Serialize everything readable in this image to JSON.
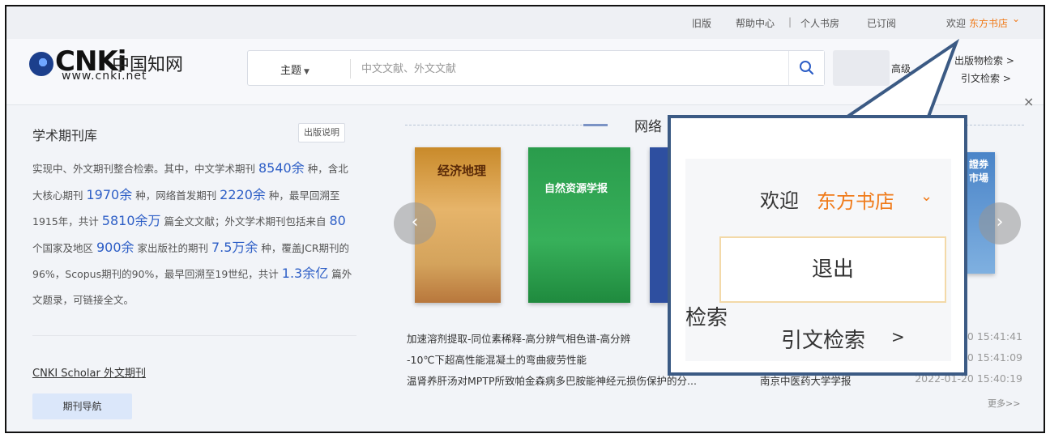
{
  "topbar": {
    "old_version": "旧版",
    "help": "帮助中心",
    "separator": "|",
    "personal": "个人书房",
    "subscribed": "已订阅",
    "welcome": "欢迎",
    "user": "东方书店",
    "caret": "⌄"
  },
  "header": {
    "logo_text": "CNKi",
    "logo_cn": "中国知网",
    "logo_url": "www.cnki.net",
    "search_type": "主题",
    "search_placeholder": "中文文献、外文文献",
    "advanced": "高级",
    "pub_search": "出版物检索  >",
    "cite_search": "引文检索  >",
    "close": "×"
  },
  "left": {
    "title": "学术期刊库",
    "note_button": "出版说明",
    "desc": [
      {
        "t": "实现中、外文期刊整合检索。其中，中文学术期刊 "
      },
      {
        "t": "8540余",
        "hl": true
      },
      {
        "t": " 种，含北大核心期刊 "
      },
      {
        "t": "1970余",
        "hl": true
      },
      {
        "t": " 种，网络首发期刊 "
      },
      {
        "t": "2220余",
        "hl": true
      },
      {
        "t": " 种，最早回溯至1915年，共计 "
      },
      {
        "t": "5810余万",
        "hl": true
      },
      {
        "t": " 篇全文文献；外文学术期刊包括来自 "
      },
      {
        "t": "80",
        "hl": true
      },
      {
        "t": " 个国家及地区 "
      },
      {
        "t": "900余",
        "hl": true
      },
      {
        "t": " 家出版社的期刊 "
      },
      {
        "t": "7.5万余",
        "hl": true
      },
      {
        "t": " 种，覆盖JCR期刊的 96%，Scopus期刊的90%，最早回溯至19世纪，共计 "
      },
      {
        "t": "1.3余亿",
        "hl": true
      },
      {
        "t": " 篇外文题录，可链接全文。"
      }
    ],
    "scholar_link": "CNKI Scholar 外文期刊",
    "nav_button": "期刊导航"
  },
  "section": {
    "title": "网络"
  },
  "covers": [
    {
      "title": "经济地理"
    },
    {
      "title": "自然资源学报"
    },
    {
      "title": ""
    },
    {
      "title": "證券市場"
    }
  ],
  "news": [
    {
      "title": "加速溶剂提取-同位素稀释-高分辨气相色谱-高分辨",
      "journal": "",
      "date": "20 15:41:41"
    },
    {
      "title": "-10℃下超高性能混凝土的弯曲疲劳性能",
      "journal": "",
      "date": "20 15:41:09"
    },
    {
      "title": "温肾养肝汤对MPTP所致帕金森病多巴胺能神经元损伤保护的分...",
      "journal": "南京中医药大学学报",
      "date": "2022-01-20 15:40:19"
    }
  ],
  "more": "更多>>",
  "callout": {
    "welcome": "欢迎",
    "user": "东方书店",
    "caret": "⌄",
    "logout": "退出",
    "left_fragment": "检索",
    "cite": "引文检索",
    "arrow": ">"
  },
  "colors": {
    "accent": "#2d5ec6",
    "user_orange": "#f07b1a",
    "callout_border": "#3b5a84"
  }
}
